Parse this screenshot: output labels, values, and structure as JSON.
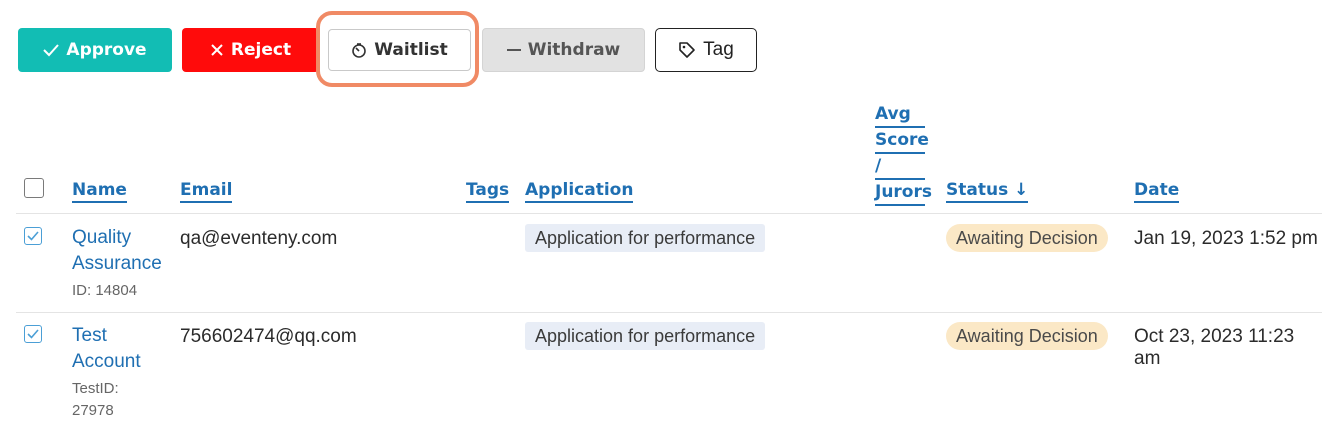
{
  "toolbar": {
    "approve": "Approve",
    "reject": "Reject",
    "waitlist": "Waitlist",
    "withdraw": "Withdraw",
    "tag": "Tag"
  },
  "table": {
    "headers": {
      "name": "Name",
      "email": "Email",
      "tags": "Tags",
      "application": "Application",
      "avg_score_lines": [
        "Avg",
        "Score",
        "/",
        "Jurors"
      ],
      "status": "Status",
      "status_sort": "↓",
      "date": "Date"
    },
    "rows": [
      {
        "checked": true,
        "name_line1": "Quality",
        "name_line2": "Assurance",
        "id_line1": "ID: 14804",
        "id_line2": "",
        "email": "qa@eventeny.com",
        "tags": "",
        "application": "Application for performance",
        "avg_score": "",
        "status": "Awaiting Decision",
        "date": "Jan 19, 2023 1:52 pm"
      },
      {
        "checked": true,
        "name_line1": "Test",
        "name_line2": "Account",
        "id_line1": "TestID:",
        "id_line2": "27978",
        "email": "756602474@qq.com",
        "tags": "",
        "application": "Application for performance",
        "avg_score": "",
        "status": "Awaiting Decision",
        "date": "Oct 23, 2023 11:23 am"
      }
    ]
  },
  "colors": {
    "approve": "#12bdb4",
    "reject": "#ff0b0b",
    "link": "#1f6fb2",
    "highlight": "#f08a65",
    "status_bg": "#fbe8c6",
    "app_bg": "#e8edf6"
  }
}
